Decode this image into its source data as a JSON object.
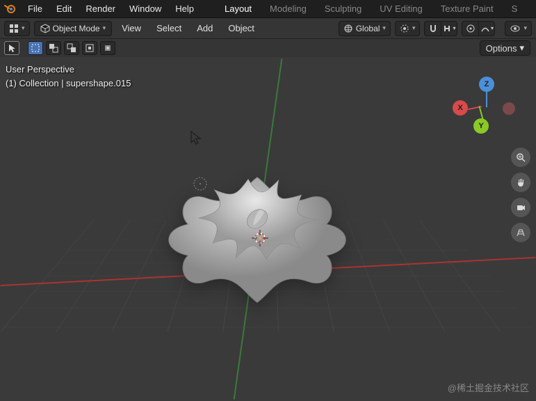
{
  "menubar": {
    "items": [
      "File",
      "Edit",
      "Render",
      "Window",
      "Help"
    ]
  },
  "tabs": {
    "items": [
      "Layout",
      "Modeling",
      "Sculpting",
      "UV Editing",
      "Texture Paint",
      "S"
    ]
  },
  "toolbar": {
    "mode_label": "Object Mode",
    "items": [
      "View",
      "Select",
      "Add",
      "Object"
    ],
    "orientation": "Global",
    "options_label": "Options"
  },
  "overlay": {
    "line1": "User Perspective",
    "line2": "(1) Collection | supershape.015"
  },
  "gizmo": {
    "x": "X",
    "y": "Y",
    "z": "Z"
  },
  "watermark": "@稀土掘金技术社区"
}
